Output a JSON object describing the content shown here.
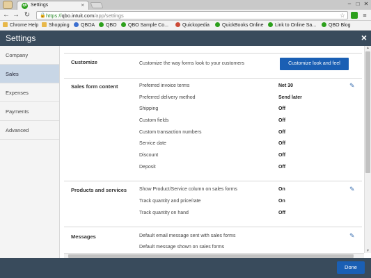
{
  "browser": {
    "tab_title": "Settings",
    "tab_favicon": "qb",
    "url_scheme": "https://",
    "url_host": "qbo.intuit.com",
    "url_path": "/app/settings",
    "bookmarks": [
      {
        "label": "Chrome Help",
        "icon": "folder-icon",
        "color": "#e8b84a"
      },
      {
        "label": "Shopping",
        "icon": "folder-icon",
        "color": "#e8b84a"
      },
      {
        "label": "QBOA",
        "icon": "qbo-icon",
        "color": "#3c6fd0"
      },
      {
        "label": "QBO",
        "icon": "qb-icon",
        "color": "#2ca01c"
      },
      {
        "label": "QBO Sample Co...",
        "icon": "qb-icon",
        "color": "#2ca01c"
      },
      {
        "label": "Quickopedia",
        "icon": "quickopedia-icon",
        "color": "#cc4b37"
      },
      {
        "label": "QuickBooks Online",
        "icon": "qb-icon",
        "color": "#2ca01c"
      },
      {
        "label": "Link to Online Sa...",
        "icon": "qb-icon",
        "color": "#2ca01c"
      },
      {
        "label": "QBO Blog",
        "icon": "qb-icon",
        "color": "#2ca01c"
      }
    ]
  },
  "header": {
    "title": "Settings",
    "close_icon": "×"
  },
  "sidebar": {
    "items": [
      {
        "label": "Company"
      },
      {
        "label": "Sales"
      },
      {
        "label": "Expenses"
      },
      {
        "label": "Payments"
      },
      {
        "label": "Advanced"
      }
    ],
    "active": "Sales"
  },
  "customize": {
    "label": "Customize",
    "description": "Customize the way forms look to your customers",
    "button": "Customize look and feel"
  },
  "sales_form_content": {
    "label": "Sales form content",
    "rows": [
      {
        "label": "Preferred invoice terms",
        "value": "Net 30"
      },
      {
        "label": "Preferred delivery method",
        "value": "Send later"
      },
      {
        "label": "Shipping",
        "value": "Off"
      },
      {
        "label": "Custom fields",
        "value": "Off"
      },
      {
        "label": "Custom transaction numbers",
        "value": "Off"
      },
      {
        "label": "Service date",
        "value": "Off"
      },
      {
        "label": "Discount",
        "value": "Off"
      },
      {
        "label": "Deposit",
        "value": "Off"
      }
    ]
  },
  "products_and_services": {
    "label": "Products and services",
    "rows": [
      {
        "label": "Show Product/Service column on sales forms",
        "value": "On"
      },
      {
        "label": "Track quantity and price/rate",
        "value": "On"
      },
      {
        "label": "Track quantity on hand",
        "value": "Off"
      }
    ]
  },
  "messages": {
    "label": "Messages",
    "rows": [
      {
        "label": "Default email message sent with sales forms",
        "value": ""
      },
      {
        "label": "Default message shown on sales forms",
        "value": ""
      }
    ]
  },
  "footer": {
    "done": "Done"
  },
  "colors": {
    "header_bg": "#394b5c",
    "primary_button": "#1a5fb4",
    "sidebar_active": "#c8d6e6"
  }
}
